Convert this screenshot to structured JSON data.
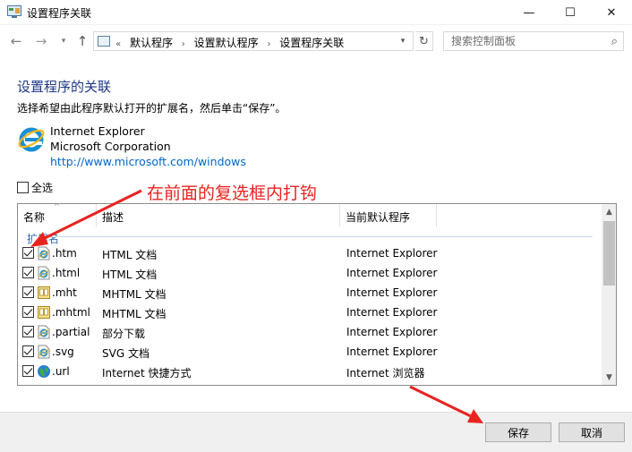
{
  "window": {
    "title": "设置程序关联",
    "minimize_glyph": "—",
    "maximize_glyph": "☐",
    "close_glyph": "✕"
  },
  "address_bar": {
    "breadcrumbs": [
      "«",
      "默认程序",
      "设置默认程序",
      "设置程序关联"
    ],
    "search_placeholder": "搜索控制面板"
  },
  "content": {
    "heading": "设置程序的关联",
    "instruction": "选择希望由此程序默认打开的扩展名，然后单击“保存”。",
    "program": {
      "name": "Internet Explorer",
      "company": "Microsoft Corporation",
      "url": "http://www.microsoft.com/windows"
    },
    "select_all_label": "全选",
    "annotation": "在前面的复选框内打钩"
  },
  "list": {
    "columns": {
      "name": "名称",
      "description": "描述",
      "current_default": "当前默认程序"
    },
    "group_label": "扩展名",
    "rows": [
      {
        "ext": ".htm",
        "desc": "HTML 文档",
        "prog": "Internet Explorer",
        "icon": "ie-file-icon",
        "checked": true
      },
      {
        "ext": ".html",
        "desc": "HTML 文档",
        "prog": "Internet Explorer",
        "icon": "ie-file-icon",
        "checked": true
      },
      {
        "ext": ".mht",
        "desc": "MHTML 文档",
        "prog": "Internet Explorer",
        "icon": "mhtml-file-icon",
        "checked": true
      },
      {
        "ext": ".mhtml",
        "desc": "MHTML 文档",
        "prog": "Internet Explorer",
        "icon": "mhtml-file-icon",
        "checked": true
      },
      {
        "ext": ".partial",
        "desc": "部分下载",
        "prog": "Internet Explorer",
        "icon": "ie-file-icon",
        "checked": true
      },
      {
        "ext": ".svg",
        "desc": "SVG 文档",
        "prog": "Internet Explorer",
        "icon": "ie-file-icon",
        "checked": true
      },
      {
        "ext": ".url",
        "desc": "Internet 快捷方式",
        "prog": "Internet 浏览器",
        "icon": "globe-icon",
        "checked": true
      }
    ]
  },
  "buttons": {
    "save": "保存",
    "cancel": "取消"
  },
  "colors": {
    "heading": "#1e3a87",
    "link": "#0066cc",
    "annotation": "#e8231f",
    "group": "#2f6ab5"
  }
}
